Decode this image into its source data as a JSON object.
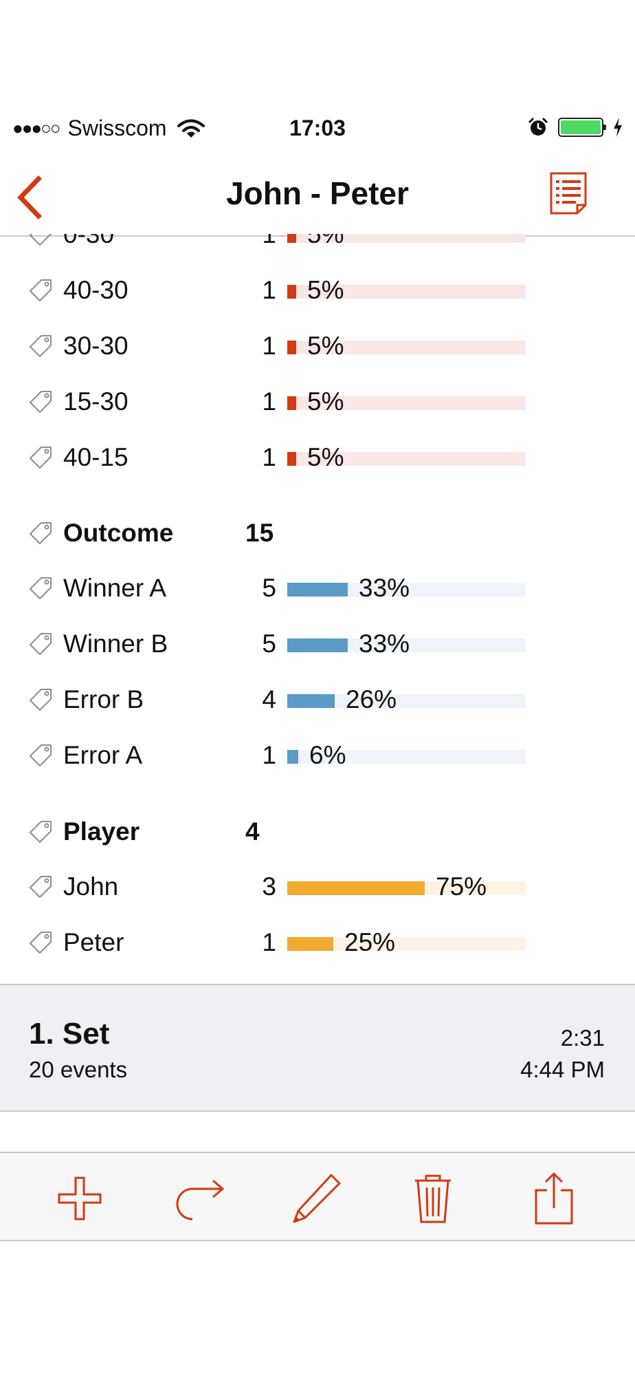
{
  "status_bar": {
    "signal": "●●●○○",
    "carrier": "Swisscom",
    "time": "17:03",
    "icons": [
      "wifi-icon",
      "alarm-icon",
      "battery-icon",
      "charging-icon"
    ]
  },
  "nav": {
    "title": "John - Peter",
    "back_icon": "chevron-left-icon",
    "right_icon": "list-icon"
  },
  "colors": {
    "accent": "#d23a12",
    "score_fill": "#d23a12",
    "score_track": "#f9e7e6",
    "outcome_fill": "#5a9ac8",
    "outcome_track": "#eef4fa",
    "player_fill": "#f2ab2e",
    "player_track": "#fdf4e6"
  },
  "stats": {
    "score_rows": [
      {
        "label": "0-30",
        "count": "1",
        "percent": "5%",
        "fraction": 0.05
      },
      {
        "label": "40-30",
        "count": "1",
        "percent": "5%",
        "fraction": 0.05
      },
      {
        "label": "30-30",
        "count": "1",
        "percent": "5%",
        "fraction": 0.05
      },
      {
        "label": "15-30",
        "count": "1",
        "percent": "5%",
        "fraction": 0.05
      },
      {
        "label": "40-15",
        "count": "1",
        "percent": "5%",
        "fraction": 0.05
      }
    ],
    "outcome": {
      "label": "Outcome",
      "total": "15",
      "rows": [
        {
          "label": "Winner A",
          "count": "5",
          "percent": "33%",
          "fraction": 0.33
        },
        {
          "label": "Winner B",
          "count": "5",
          "percent": "33%",
          "fraction": 0.33
        },
        {
          "label": "Error B",
          "count": "4",
          "percent": "26%",
          "fraction": 0.26
        },
        {
          "label": "Error A",
          "count": "1",
          "percent": "6%",
          "fraction": 0.06
        }
      ]
    },
    "player": {
      "label": "Player",
      "total": "4",
      "rows": [
        {
          "label": "John",
          "count": "3",
          "percent": "75%",
          "fraction": 0.75
        },
        {
          "label": "Peter",
          "count": "1",
          "percent": "25%",
          "fraction": 0.25
        }
      ]
    }
  },
  "set": {
    "title": "1. Set",
    "events": "20 events",
    "duration": "2:31",
    "time": "4:44 PM"
  },
  "toolbar": {
    "icons": [
      "plus-icon",
      "redo-icon",
      "pencil-icon",
      "trash-icon",
      "share-icon"
    ]
  }
}
